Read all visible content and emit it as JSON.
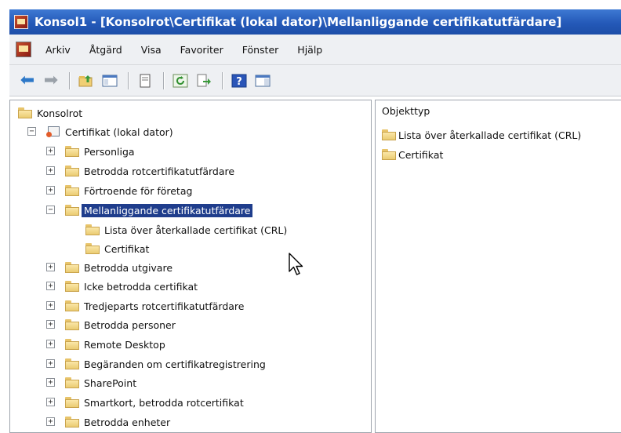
{
  "window": {
    "title": "Konsol1 - [Konsolrot\\Certifikat (lokal dator)\\Mellanliggande certifikatutfärdare]"
  },
  "menu": {
    "items": [
      "Arkiv",
      "Åtgärd",
      "Visa",
      "Favoriter",
      "Fönster",
      "Hjälp"
    ]
  },
  "toolbar": {
    "buttons": [
      "back-arrow-icon",
      "forward-arrow-icon",
      "up-folder-icon",
      "show-hide-tree-icon",
      "properties-icon",
      "refresh-icon",
      "export-list-icon",
      "help-icon",
      "action-pane-icon"
    ]
  },
  "tree": {
    "root": "Konsolrot",
    "computer": "Certifikat (lokal dator)",
    "items": [
      "Personliga",
      "Betrodda rotcertifikatutfärdare",
      "Förtroende för företag",
      "Mellanliggande certifikatutfärdare",
      "Lista över återkallade certifikat (CRL)",
      "Certifikat",
      "Betrodda utgivare",
      "Icke betrodda certifikat",
      "Tredjeparts rotcertifikatutfärdare",
      "Betrodda personer",
      "Remote Desktop",
      "Begäranden om certifikatregistrering",
      "SharePoint",
      "Smartkort, betrodda rotcertifikat",
      "Betrodda enheter"
    ],
    "selected": "Mellanliggande certifikatutfärdare"
  },
  "details": {
    "column_header": "Objekttyp",
    "items": [
      "Lista över återkallade certifikat (CRL)",
      "Certifikat"
    ]
  },
  "colors": {
    "titlebar": "#2459b8",
    "selection": "#1f3d8c",
    "folder": "#eacb72"
  }
}
